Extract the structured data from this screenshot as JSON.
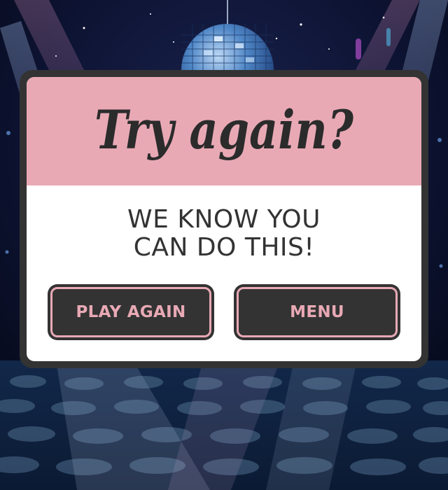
{
  "dialog": {
    "title": "Try again?",
    "message_line1": "WE KNOW YOU",
    "message_line2": "CAN DO THIS!"
  },
  "buttons": {
    "play_again_label": "PLAY AGAIN",
    "menu_label": "MENU"
  },
  "colors": {
    "accent_pink": "#e8a9b5",
    "dark_frame": "#333333",
    "panel_white": "#ffffff",
    "scene_background": "#0a0f24"
  },
  "icons": {
    "decoration": "disco-ball-icon"
  }
}
